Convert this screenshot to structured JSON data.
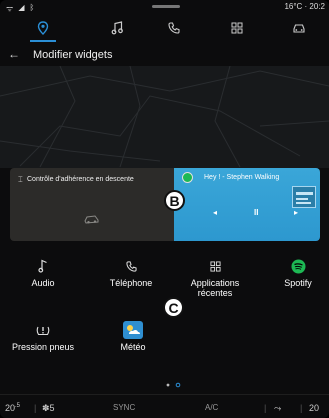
{
  "status_bar": {
    "temp_and_time": "16°C · 20:2"
  },
  "nav": {
    "tabs": [
      {
        "id": "navigation",
        "icon": "map-pin-icon",
        "active": true
      },
      {
        "id": "music",
        "icon": "music-note-icon",
        "active": false
      },
      {
        "id": "phone",
        "icon": "phone-icon",
        "active": false
      },
      {
        "id": "apps",
        "icon": "apps-grid-icon",
        "active": false
      },
      {
        "id": "vehicle",
        "icon": "car-icon",
        "active": false
      }
    ],
    "accent_color": "#2b8fd6"
  },
  "header": {
    "back": "←",
    "title": "Modifier widgets"
  },
  "widgets": {
    "left": {
      "label": "Contrôle d'adhérence en descente"
    },
    "right": {
      "track": "Hey ! - Stephen Walking",
      "controls": {
        "previous": "◂",
        "pause": "II",
        "next": "▸"
      }
    }
  },
  "callouts": {
    "b": "B",
    "c": "C"
  },
  "apps": [
    {
      "label": "Audio",
      "icon": "music-note-icon"
    },
    {
      "label": "Téléphone",
      "icon": "phone-icon"
    },
    {
      "label": "Applications récentes",
      "icon": "apps-grid-icon"
    },
    {
      "label": "Spotify",
      "icon": "spotify-icon"
    },
    {
      "label": "Pression pneus",
      "icon": "tire-pressure-icon"
    },
    {
      "label": "Météo",
      "icon": "weather-icon"
    }
  ],
  "bottom_bar": {
    "temp_left": "20",
    "fan_speed": "5",
    "sync": "SYNC",
    "ac": "A/C",
    "temp_right": "20"
  }
}
